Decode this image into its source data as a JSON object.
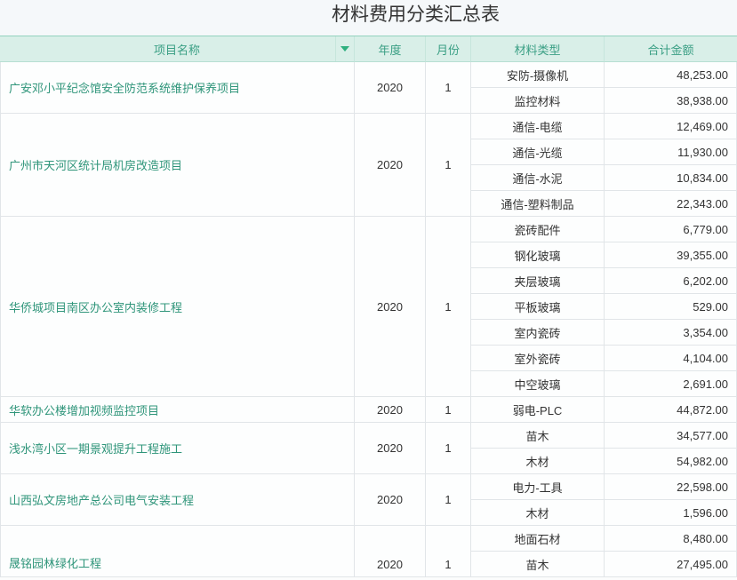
{
  "title": "材料费用分类汇总表",
  "header": {
    "project": "项目名称",
    "year": "年度",
    "month": "月份",
    "material_type": "材料类型",
    "total_amount": "合计金额",
    "filter_icon": "triangle-down-icon"
  },
  "colors": {
    "accent": "#2eb07f",
    "header_background": "#d9efe8",
    "header_text": "#3a9f84",
    "link_text": "#2f957a"
  },
  "groups": [
    {
      "project": "广安邓小平纪念馆安全防范系统维护保养项目",
      "year": "2020",
      "month": "1",
      "items": [
        {
          "material_type": "安防-摄像机",
          "amount": "48,253.00"
        },
        {
          "material_type": "监控材料",
          "amount": "38,938.00"
        }
      ]
    },
    {
      "project": "广州市天河区统计局机房改造项目",
      "year": "2020",
      "month": "1",
      "items": [
        {
          "material_type": "通信-电缆",
          "amount": "12,469.00"
        },
        {
          "material_type": "通信-光缆",
          "amount": "11,930.00"
        },
        {
          "material_type": "通信-水泥",
          "amount": "10,834.00"
        },
        {
          "material_type": "通信-塑料制品",
          "amount": "22,343.00"
        }
      ]
    },
    {
      "project": "华侨城项目南区办公室内装修工程",
      "year": "2020",
      "month": "1",
      "items": [
        {
          "material_type": "瓷砖配件",
          "amount": "6,779.00"
        },
        {
          "material_type": "钢化玻璃",
          "amount": "39,355.00"
        },
        {
          "material_type": "夹层玻璃",
          "amount": "6,202.00"
        },
        {
          "material_type": "平板玻璃",
          "amount": "529.00"
        },
        {
          "material_type": "室内瓷砖",
          "amount": "3,354.00"
        },
        {
          "material_type": "室外瓷砖",
          "amount": "4,104.00"
        },
        {
          "material_type": "中空玻璃",
          "amount": "2,691.00"
        }
      ]
    },
    {
      "project": "华软办公楼增加视频监控项目",
      "year": "2020",
      "month": "1",
      "items": [
        {
          "material_type": "弱电-PLC",
          "amount": "44,872.00"
        }
      ]
    },
    {
      "project": "浅水湾小区一期景观提升工程施工",
      "year": "2020",
      "month": "1",
      "items": [
        {
          "material_type": "苗木",
          "amount": "34,577.00"
        },
        {
          "material_type": "木材",
          "amount": "54,982.00"
        }
      ]
    },
    {
      "project": "山西弘文房地产总公司电气安装工程",
      "year": "2020",
      "month": "1",
      "items": [
        {
          "material_type": "电力-工具",
          "amount": "22,598.00"
        },
        {
          "material_type": "木材",
          "amount": "1,596.00"
        }
      ]
    },
    {
      "project": "晟铭园林绿化工程",
      "year": "2020",
      "month": "1",
      "items": [
        {
          "material_type": "地面石材",
          "amount": "8,480.00"
        },
        {
          "material_type": "苗木",
          "amount": "27,495.00"
        }
      ]
    }
  ]
}
